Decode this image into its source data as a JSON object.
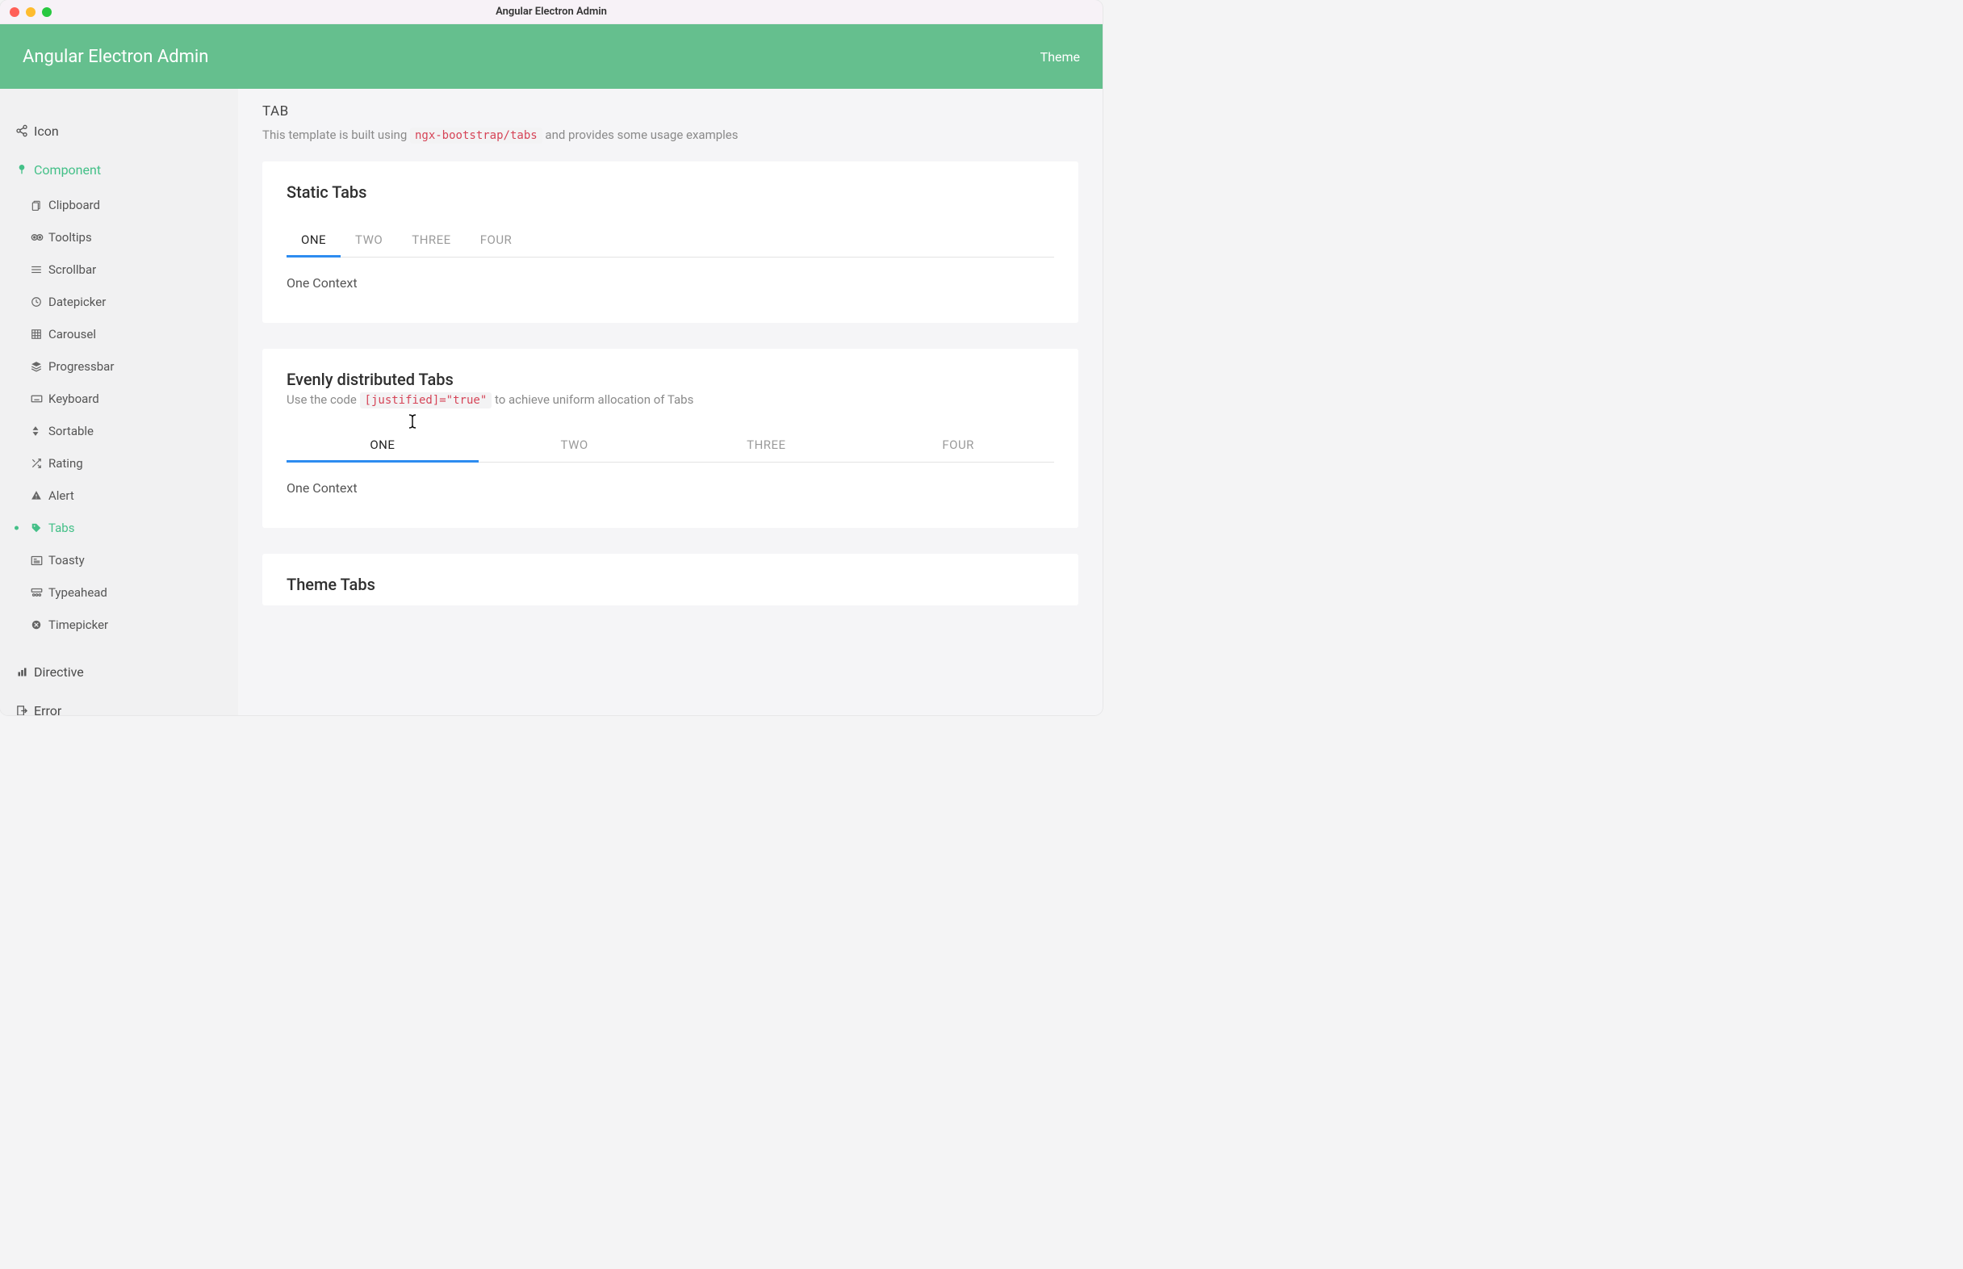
{
  "window_title": "Angular Electron Admin",
  "header": {
    "title": "Angular Electron Admin",
    "theme_link": "Theme"
  },
  "sidebar": {
    "top": [
      {
        "id": "icon",
        "label": "Icon",
        "icon": "share"
      },
      {
        "id": "component",
        "label": "Component",
        "icon": "tree",
        "active": true
      },
      {
        "id": "directive",
        "label": "Directive",
        "icon": "bar-chart"
      },
      {
        "id": "error",
        "label": "Error",
        "icon": "exit"
      }
    ],
    "sub": [
      {
        "id": "clipboard",
        "label": "Clipboard",
        "icon": "clipboard"
      },
      {
        "id": "tooltips",
        "label": "Tooltips",
        "icon": "eyes"
      },
      {
        "id": "scrollbar",
        "label": "Scrollbar",
        "icon": "list"
      },
      {
        "id": "datepicker",
        "label": "Datepicker",
        "icon": "clock"
      },
      {
        "id": "carousel",
        "label": "Carousel",
        "icon": "grid"
      },
      {
        "id": "progressbar",
        "label": "Progressbar",
        "icon": "stack"
      },
      {
        "id": "keyboard",
        "label": "Keyboard",
        "icon": "keyboard"
      },
      {
        "id": "sortable",
        "label": "Sortable",
        "icon": "sort"
      },
      {
        "id": "rating",
        "label": "Rating",
        "icon": "shuffle"
      },
      {
        "id": "alert",
        "label": "Alert",
        "icon": "warning"
      },
      {
        "id": "tabs",
        "label": "Tabs",
        "icon": "tag",
        "active": true
      },
      {
        "id": "toasty",
        "label": "Toasty",
        "icon": "news"
      },
      {
        "id": "typeahead",
        "label": "Typeahead",
        "icon": "typeahead"
      },
      {
        "id": "timepicker",
        "label": "Timepicker",
        "icon": "timepicker"
      }
    ]
  },
  "page": {
    "title": "TAB",
    "desc_pre": "This template is built using ",
    "desc_code": "ngx-bootstrap/tabs",
    "desc_post": " and provides some usage examples"
  },
  "card_static": {
    "title": "Static Tabs",
    "tabs": [
      "ONE",
      "TWO",
      "THREE",
      "FOUR"
    ],
    "content": "One Context"
  },
  "card_even": {
    "title": "Evenly distributed Tabs",
    "sub_pre": "Use the code ",
    "sub_code": "[justified]=\"true\"",
    "sub_post": " to achieve uniform allocation of Tabs",
    "tabs": [
      "ONE",
      "TWO",
      "THREE",
      "FOUR"
    ],
    "content": "One Context"
  },
  "card_theme": {
    "title": "Theme Tabs"
  }
}
